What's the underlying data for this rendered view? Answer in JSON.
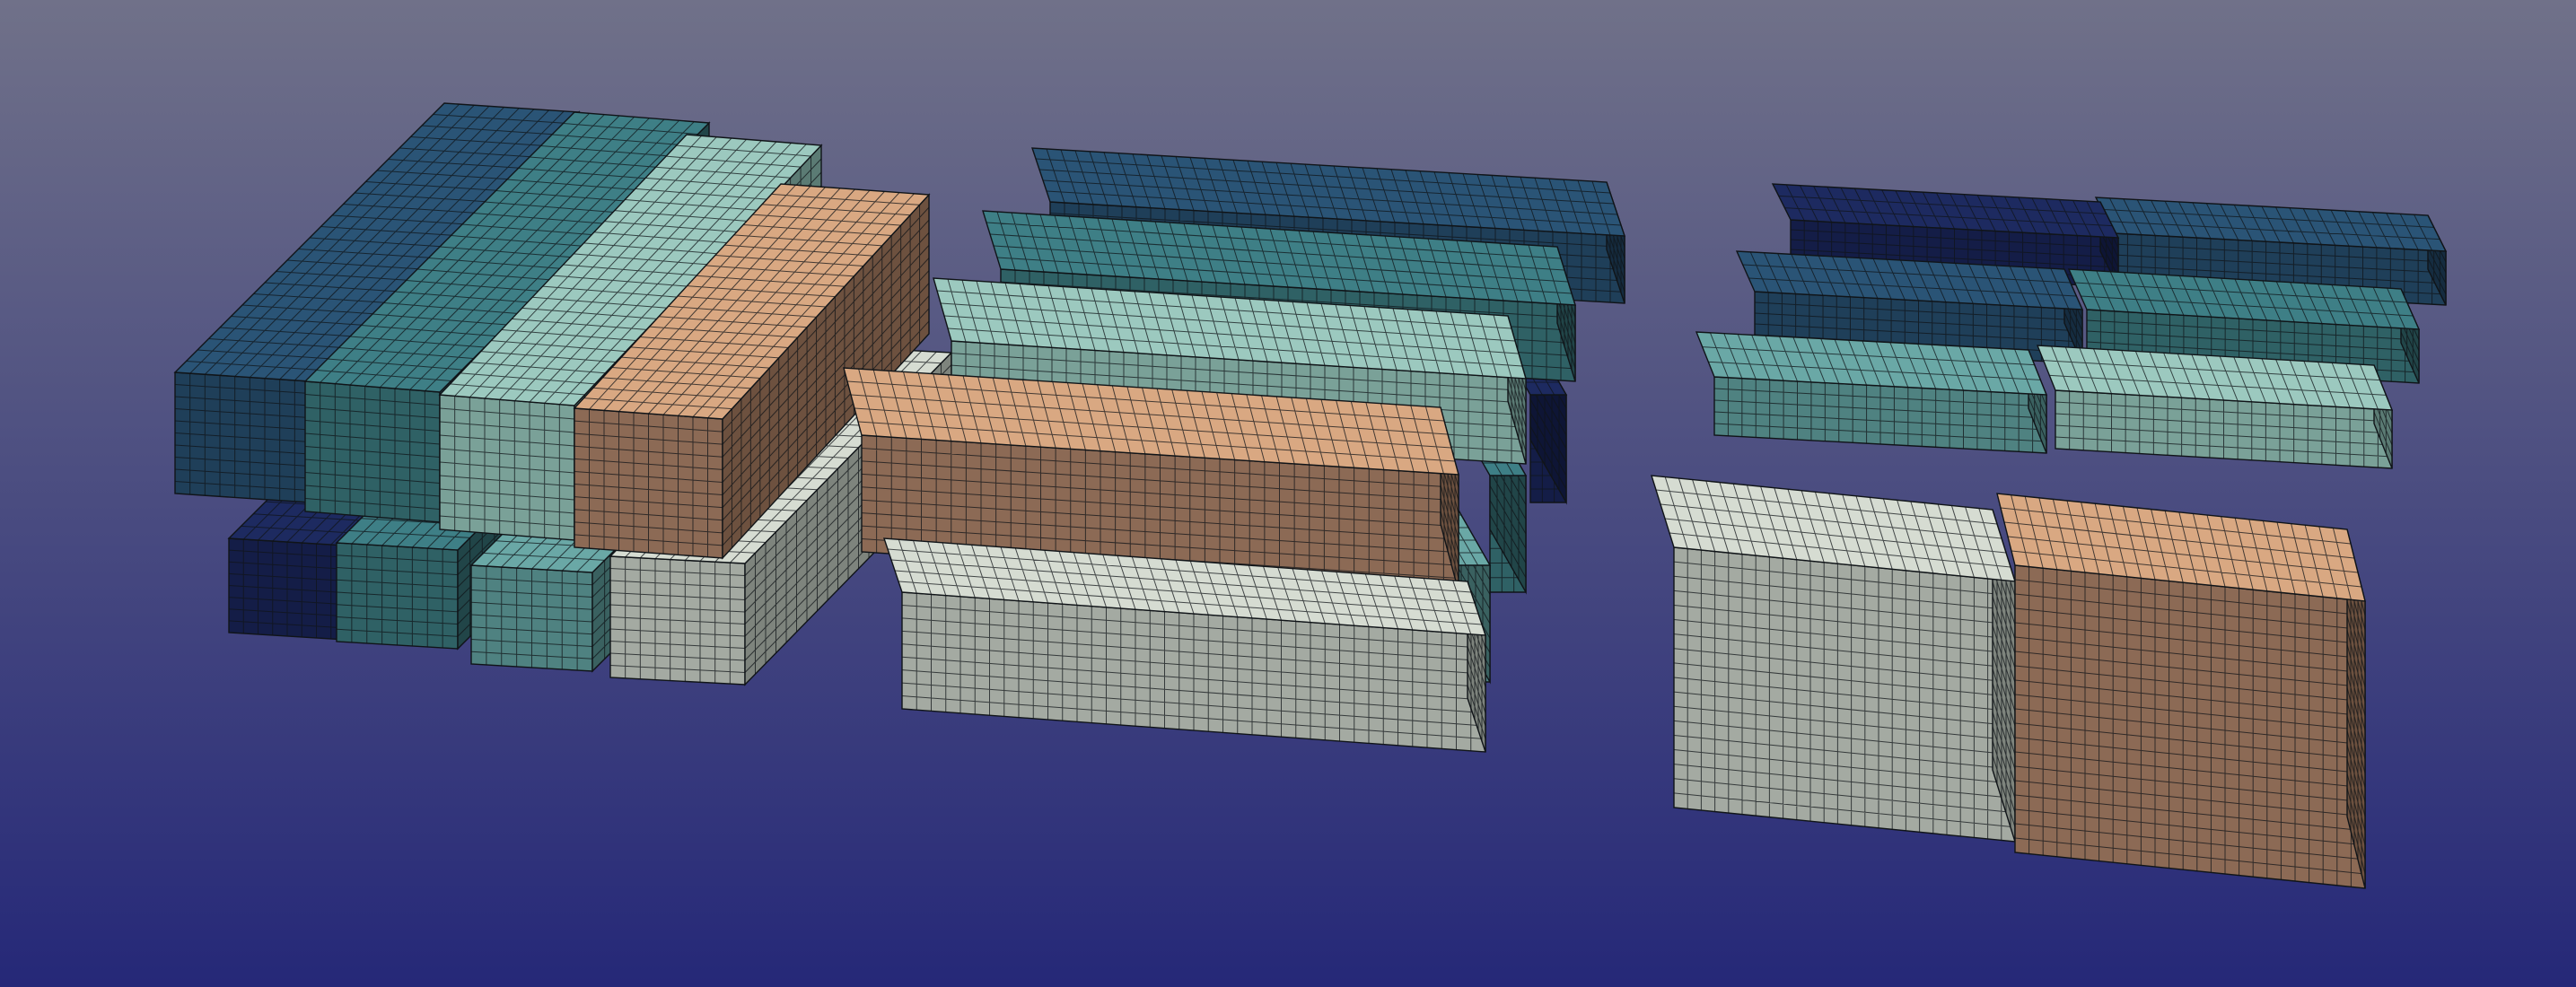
{
  "viewport": {
    "background_top": "#707189",
    "background_bottom": "#252878"
  },
  "mesh": {
    "edge_color": "#101418",
    "grid_divisions_long": 40,
    "grid_divisions_short": 12
  },
  "palette": {
    "navy": {
      "top": "#1d2a60",
      "front": "#141d47",
      "side": "#0e1535"
    },
    "dark_blue": {
      "top": "#2a5476",
      "front": "#1f3f59",
      "side": "#152c40"
    },
    "dark_teal": {
      "top": "#3e7f86",
      "front": "#2f6165",
      "side": "#214548"
    },
    "teal": {
      "top": "#6aa8a6",
      "front": "#4f8281",
      "side": "#3a6160"
    },
    "light_teal": {
      "top": "#9cc9bf",
      "front": "#7aa198",
      "side": "#5b7b74"
    },
    "pale": {
      "top": "#d6dcd2",
      "front": "#a4aaa2",
      "side": "#7e847d"
    },
    "tan": {
      "top": "#d9a882",
      "front": "#8c6a55",
      "side": "#6d513f"
    }
  },
  "groups": [
    {
      "name": "left-block-group",
      "block_colors": [
        "navy",
        "dark_blue",
        "dark_teal",
        "teal",
        "light_teal",
        "pale",
        "tan"
      ]
    },
    {
      "name": "middle-block-group",
      "block_colors": [
        "dark_blue",
        "dark_teal",
        "light_teal",
        "tan",
        "pale",
        "teal"
      ]
    },
    {
      "name": "right-block-group",
      "block_colors": [
        "navy",
        "dark_blue",
        "dark_teal",
        "teal",
        "light_teal",
        "pale",
        "tan"
      ]
    }
  ]
}
